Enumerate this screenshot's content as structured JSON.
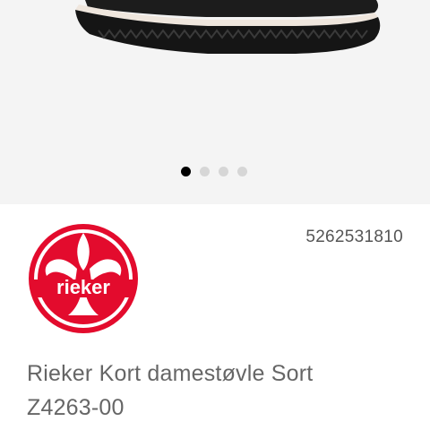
{
  "gallery": {
    "image_icon": "boot-image",
    "slides": 4,
    "active_index": 0
  },
  "product": {
    "number": "5262531810",
    "brand_logo_text": "rieker",
    "brand_color": "#e30b2d",
    "title_line1": "Rieker Kort damestøvle Sort",
    "title_line2": "Z4263-00"
  }
}
